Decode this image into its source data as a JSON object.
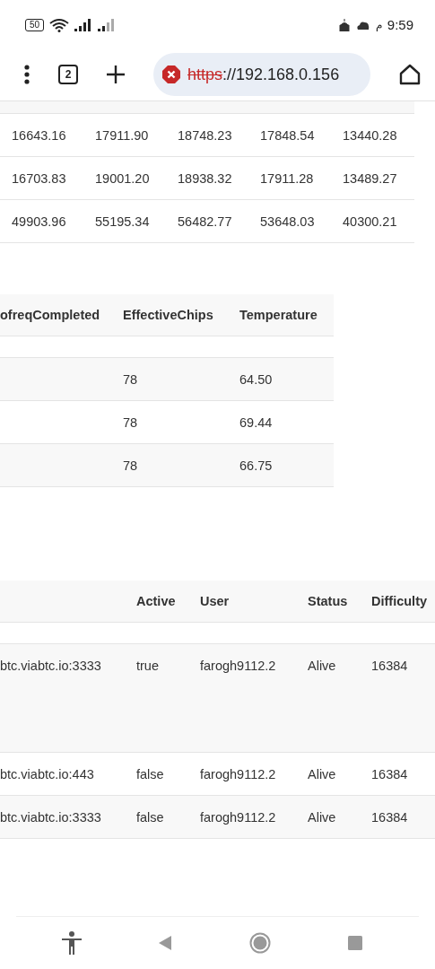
{
  "status_bar": {
    "battery": "50",
    "am_pm": "م",
    "time": "9:59"
  },
  "toolbar": {
    "tab_count": "2",
    "url_scheme": "https",
    "url_rest": "://192.168.0.156"
  },
  "tables": [
    {
      "rows": [
        [
          "16643.16",
          "17911.90",
          "18748.23",
          "17848.54",
          "13440.28"
        ],
        [
          "16703.83",
          "19001.20",
          "18938.32",
          "17911.28",
          "13489.27"
        ],
        [
          "49903.96",
          "55195.34",
          "56482.77",
          "53648.03",
          "40300.21"
        ]
      ]
    },
    {
      "columns": [
        "ofreqCompleted",
        "EffectiveChips",
        "Temperature"
      ],
      "rows": [
        [
          "",
          "78",
          "64.50"
        ],
        [
          "",
          "78",
          "69.44"
        ],
        [
          "",
          "78",
          "66.75"
        ]
      ]
    },
    {
      "columns": [
        "",
        "Active",
        "User",
        "Status",
        "Difficulty"
      ],
      "rows": [
        [
          "btc.viabtc.io:3333",
          "true",
          "farogh9112.2",
          "Alive",
          "16384"
        ],
        [
          "btc.viabtc.io:443",
          "false",
          "farogh9112.2",
          "Alive",
          "16384"
        ],
        [
          "btc.viabtc.io:3333",
          "false",
          "farogh9112.2",
          "Alive",
          "16384"
        ]
      ]
    }
  ]
}
